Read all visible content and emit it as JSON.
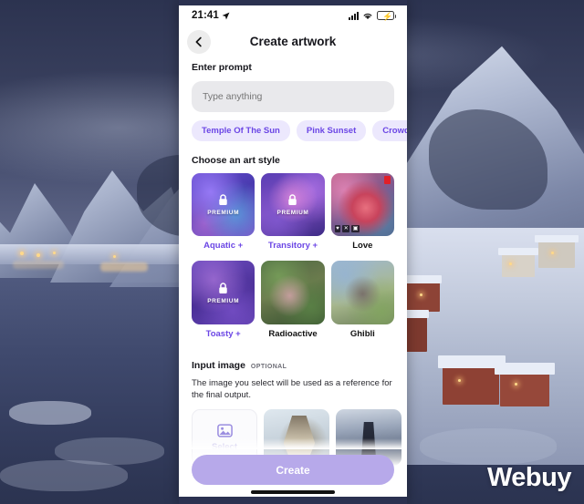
{
  "background": {
    "description": "Snowy fjord village at dusk with mountains and reflective water",
    "watermark": "Webuy"
  },
  "phone": {
    "status_bar": {
      "time": "21:41",
      "location_icon": "location-arrow-icon",
      "cellular_icon": "cellular-signal-icon",
      "wifi_icon": "wifi-icon",
      "battery_icon": "battery-charging-icon",
      "battery_color": "#5ac46a"
    },
    "header": {
      "back_icon": "chevron-left-icon",
      "title": "Create artwork"
    },
    "prompt": {
      "label": "Enter prompt",
      "placeholder": "Type anything",
      "value": "",
      "suggestions": [
        {
          "label": "Temple Of The Sun"
        },
        {
          "label": "Pink Sunset"
        },
        {
          "label": "Crowded"
        }
      ]
    },
    "art_style": {
      "label": "Choose an art style",
      "tiles": [
        {
          "label": "Aquatic +",
          "premium": true,
          "premium_word": "PREMIUM",
          "lock_icon": "lock-icon"
        },
        {
          "label": "Transitory +",
          "premium": true,
          "premium_word": "PREMIUM",
          "lock_icon": "lock-icon"
        },
        {
          "label": "Love",
          "premium": false
        },
        {
          "label": "Toasty +",
          "premium": true,
          "premium_word": "PREMIUM",
          "lock_icon": "lock-icon"
        },
        {
          "label": "Radioactive",
          "premium": false
        },
        {
          "label": "Ghibli",
          "premium": false
        }
      ]
    },
    "input_image": {
      "title": "Input image",
      "optional_tag": "OPTIONAL",
      "description": "The image you select will be used as a reference for the final output.",
      "select_card": {
        "label": "Select",
        "icon": "image-picker-icon"
      },
      "thumbnails": [
        {
          "name": "owl-photo-thumbnail"
        },
        {
          "name": "library-corridor-photo-thumbnail"
        }
      ]
    },
    "create_button": {
      "label": "Create",
      "color": "#b7a9ea"
    },
    "home_indicator": "home-indicator"
  },
  "colors": {
    "accent_purple": "#6b46e5",
    "chip_bg": "#ece8fd",
    "input_bg": "#e9e9ec",
    "create_bg": "#b7a9ea"
  }
}
